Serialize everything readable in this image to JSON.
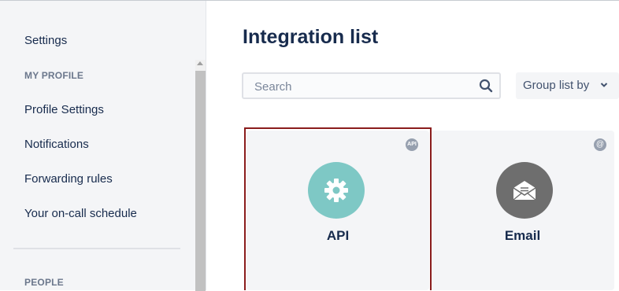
{
  "sidebar": {
    "settings_label": "Settings",
    "my_profile_heading": "MY PROFILE",
    "items": [
      {
        "label": "Profile Settings"
      },
      {
        "label": "Notifications"
      },
      {
        "label": "Forwarding rules"
      },
      {
        "label": "Your on-call schedule"
      }
    ],
    "people_heading": "PEOPLE"
  },
  "main": {
    "title": "Integration list",
    "search": {
      "placeholder": "Search",
      "value": ""
    },
    "group_by_label": "Group list by",
    "integrations": [
      {
        "name": "API",
        "badge": "API",
        "icon": "gear-icon",
        "color": "#7ec8c5",
        "selected": true
      },
      {
        "name": "Email",
        "badge": "@",
        "icon": "envelope-icon",
        "color": "#6e6e6e",
        "selected": false
      }
    ]
  },
  "colors": {
    "selected_outline": "#8a1c1c",
    "card_bg": "#f4f5f7",
    "text": "#172b4d"
  }
}
